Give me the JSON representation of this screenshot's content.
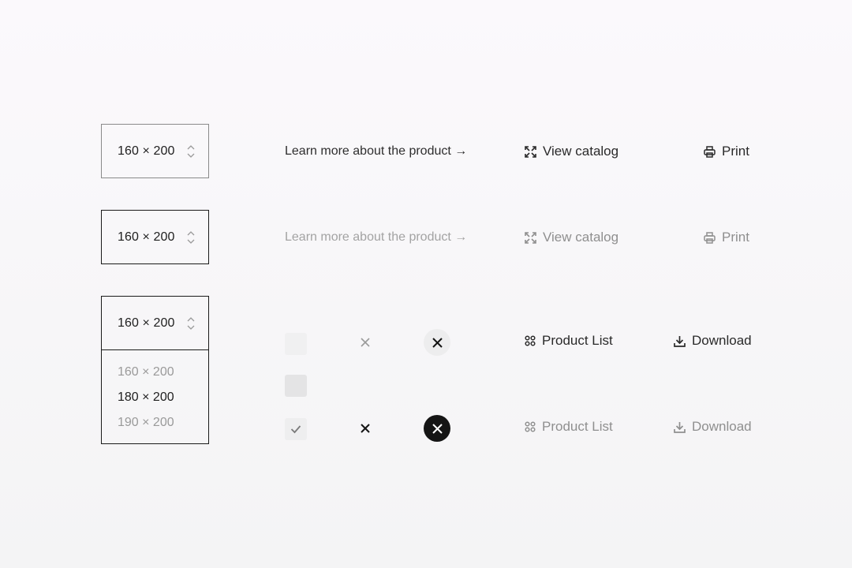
{
  "size_selectors": [
    {
      "value": "160 × 200"
    },
    {
      "value": "160 × 200"
    },
    {
      "value": "160 × 200"
    }
  ],
  "dropdown": {
    "options": [
      "160 × 200",
      "180 × 200",
      "190 × 200"
    ],
    "selected_index": 1
  },
  "links": {
    "default": "Learn more about the product →",
    "disabled": "Learn more about the product →"
  },
  "actions": {
    "view_catalog": "View catalog",
    "view_catalog_muted": "View catalog",
    "print": "Print",
    "print_muted": "Print",
    "product_list": "Product List",
    "product_list_muted": "Product List",
    "download": "Download",
    "download_muted": "Download"
  },
  "icons": [
    "stepper-icon",
    "expand-icon",
    "printer-icon",
    "grid-icon",
    "download-icon",
    "check-icon",
    "close-icon"
  ],
  "colors": {
    "border": "#1a1a1a",
    "muted_text": "#9a9a9a",
    "dark_circle": "#151515"
  }
}
